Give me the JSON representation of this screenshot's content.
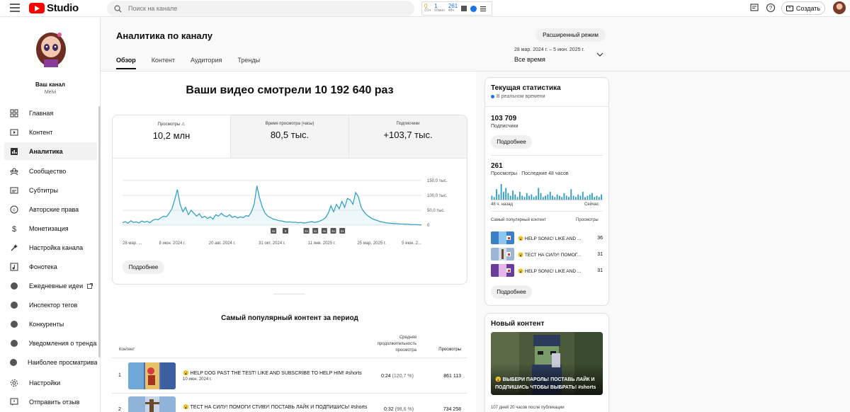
{
  "topbar": {
    "logo_text": "Studio",
    "search_placeholder": "Поиск на канале",
    "ext_stats": [
      {
        "value": "0",
        "label": "⏱1ч"
      },
      {
        "value": "1",
        "label": "60мин"
      },
      {
        "value": "261",
        "label": "48ч"
      }
    ],
    "create_label": "Создать"
  },
  "sidebar": {
    "channel_name": "Ваш канал",
    "channel_handle": "Melvi",
    "items": [
      {
        "label": "Главная",
        "icon": "dashboard-icon"
      },
      {
        "label": "Контент",
        "icon": "content-icon"
      },
      {
        "label": "Аналитика",
        "icon": "analytics-icon"
      },
      {
        "label": "Сообщество",
        "icon": "community-icon"
      },
      {
        "label": "Субтитры",
        "icon": "subtitles-icon"
      },
      {
        "label": "Авторские права",
        "icon": "copyright-icon"
      },
      {
        "label": "Монетизация",
        "icon": "monetization-icon"
      },
      {
        "label": "Настройка канала",
        "icon": "customization-icon"
      },
      {
        "label": "Фонотека",
        "icon": "audio-library-icon"
      },
      {
        "label": "Ежедневные идеи",
        "icon": "extension-icon"
      },
      {
        "label": "Инспектор тегов",
        "icon": "extension-icon"
      },
      {
        "label": "Конкуренты",
        "icon": "extension-icon"
      },
      {
        "label": "Уведомления о трендах",
        "icon": "extension-icon"
      },
      {
        "label": "Наиболее просматриваемые",
        "icon": "extension-icon"
      },
      {
        "label": "Настройки",
        "icon": "settings-icon"
      },
      {
        "label": "Отправить отзыв",
        "icon": "feedback-icon"
      }
    ]
  },
  "header": {
    "title": "Аналитика по каналу",
    "tabs": [
      "Обзор",
      "Контент",
      "Аудитория",
      "Тренды"
    ],
    "advanced_mode": "Расширенный режим",
    "date_range": "28 мар. 2024 г. – 5 июн. 2025 г.",
    "date_label": "Все время"
  },
  "overview": {
    "headline": "Ваши видео смотрели 10 192 640 раз",
    "metrics": [
      {
        "label": "Просмотры",
        "value": "10,2 млн"
      },
      {
        "label": "Время просмотра (часы)",
        "value": "80,5 тыс."
      },
      {
        "label": "Подписчики",
        "value": "+103,7 тыс."
      }
    ],
    "more_label": "Подробнее"
  },
  "chart_data": {
    "type": "line",
    "title": "",
    "xlabel": "",
    "ylabel": "",
    "ylim": [
      0,
      150000
    ],
    "y_ticks": [
      "150,0 тыс.",
      "100,0 тыс.",
      "50,0 тыс.",
      "0"
    ],
    "x_ticks": [
      "28 мар. ...",
      "8 июн. 2024 г.",
      "20 авг. 2024 г.",
      "31 окт. 2024 г.",
      "11 янв. 2025 г.",
      "25 мар. 2025 г.",
      "5 июн. 2..."
    ],
    "series": [
      {
        "values": [
          8000,
          12000,
          6000,
          15000,
          9000,
          11000,
          7000,
          14000,
          10000,
          13000,
          8000,
          16000,
          20000,
          18000,
          25000,
          30000,
          28000,
          40000,
          55000,
          85000,
          120000,
          70000,
          45000,
          60000,
          35000,
          50000,
          40000,
          30000,
          38000,
          25000,
          30000,
          22000,
          28000,
          20000,
          35000,
          30000,
          40000,
          32000,
          28000,
          35000,
          26000,
          30000,
          24000,
          28000,
          25000,
          32000,
          30000,
          45000,
          70000,
          132000,
          90000,
          60000,
          40000,
          30000,
          25000,
          20000,
          18000,
          15000,
          14000,
          12000,
          10000,
          11000,
          9000,
          10000,
          8000,
          9000,
          7000,
          8000,
          10000,
          12000,
          9000,
          11000,
          14000,
          18000,
          25000,
          40000,
          65000,
          45000,
          70000,
          55000,
          80000,
          60000,
          90000,
          85000,
          70000,
          110000,
          95000,
          60000,
          45000,
          35000,
          28000,
          22000,
          18000,
          15000,
          12000,
          10000,
          8000,
          7000,
          6000,
          5000,
          5000,
          4000,
          4000,
          3000,
          3000,
          2000,
          2000,
          2000,
          1000,
          1000
        ]
      }
    ],
    "event_markers": [
      "4x",
      "8",
      "4x",
      "4x",
      "4x",
      "4x",
      "4x"
    ]
  },
  "top_content": {
    "title": "Самый популярный контент за период",
    "col_content": "Контент",
    "col_duration": "Средняя продолжительность просмотра",
    "col_views": "Просмотры",
    "rows": [
      {
        "index": "1",
        "title": "😮 HELP DOG PAST THE TEST! LIKE AND SUBSCRIBE TO HELP HIM! #shorts",
        "date": "10 июн. 2024 г.",
        "duration": "0:24",
        "percent": "(120,7 %)",
        "views": "861 113"
      },
      {
        "index": "2",
        "title": "😮 ТЕСТ НА СИЛУ! ПОМОГИ СТИВУ! ПОСТАВЬ ЛАЙК И ПОДПИШИСЬ! #shorts",
        "date": "",
        "duration": "0:32",
        "percent": "(98,6 %)",
        "views": "734 258"
      }
    ]
  },
  "realtime": {
    "title": "Текущая статистика",
    "live_label": "В реальном времени",
    "subs_value": "103 709",
    "subs_label": "Подписчики",
    "more_label": "Подробнее",
    "views_value": "261",
    "views_label": "Просмотры · Последние 48 часов",
    "axis_left": "48 ч. назад",
    "axis_right": "Сейчас",
    "bars": [
      3,
      2,
      8,
      4,
      12,
      6,
      9,
      5,
      3,
      7,
      4,
      2,
      6,
      3,
      2,
      5,
      3,
      4,
      2,
      3,
      9,
      5,
      2,
      3,
      4,
      6,
      3,
      2,
      4,
      3,
      2,
      5,
      3,
      2,
      8,
      3,
      2,
      4,
      3,
      6,
      2,
      3,
      4,
      5,
      2,
      3,
      2,
      4
    ],
    "top_label": "Самый популярный контент",
    "top_views_label": "Просмотры",
    "top_rows": [
      {
        "title": "😮 HELP SONIC! LIKE AND ...",
        "views": "36"
      },
      {
        "title": "😮 ТЕСТ НА СИЛУ! ПОМОГ...",
        "views": "31"
      },
      {
        "title": "😮 HELP SONIC! LIKE AND ...",
        "views": "31"
      }
    ]
  },
  "new_content": {
    "title": "Новый контент",
    "caption": "😮 ВЫБЕРИ ПАРОЛЬ! ПОСТАВЬ ЛАЙК И ПОДПИШИСЬ ЧТОБЫ ВЫБРАТЬ! #shorts",
    "meta": "107 дней 20 часов после публикации"
  },
  "colors": {
    "accent": "#2a9cc4",
    "brand": "#ff0000",
    "live": "#1a73e8"
  }
}
